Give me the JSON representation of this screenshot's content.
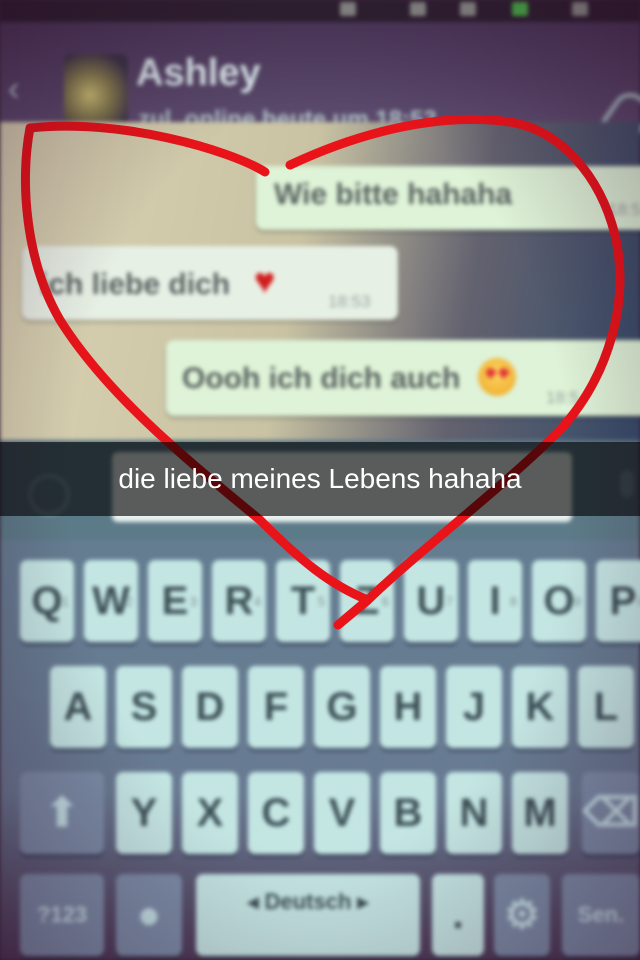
{
  "chat_header": {
    "contact_name": "Ashley",
    "last_seen": "zul. online heute um 18:53"
  },
  "messages": [
    {
      "direction": "outgoing",
      "text": "Wie bitte hahaha",
      "time": "18:5"
    },
    {
      "direction": "incoming",
      "text": "ich liebe dich",
      "emoji": "red-heart",
      "time": "18:53"
    },
    {
      "direction": "outgoing",
      "text": "Oooh ich dich auch",
      "emoji": "heart-eyes-smiley",
      "time": "18:5"
    }
  ],
  "caption": "die liebe meines Lebens hahaha",
  "keyboard": {
    "row1": [
      {
        "label": "Q",
        "num": "1"
      },
      {
        "label": "W",
        "num": "2"
      },
      {
        "label": "E",
        "num": "3"
      },
      {
        "label": "R",
        "num": "4"
      },
      {
        "label": "T",
        "num": "5"
      },
      {
        "label": "Z",
        "num": "6"
      },
      {
        "label": "U",
        "num": "7"
      },
      {
        "label": "I",
        "num": "8"
      },
      {
        "label": "O",
        "num": "9"
      },
      {
        "label": "P",
        "num": "0"
      }
    ],
    "row2": [
      "A",
      "S",
      "D",
      "F",
      "G",
      "H",
      "J",
      "K",
      "L"
    ],
    "row3": [
      "Y",
      "X",
      "C",
      "V",
      "B",
      "N",
      "M"
    ],
    "symbols_key": "?123",
    "space_label": "Deutsch",
    "period": ".",
    "send_key": "Sen."
  },
  "drawing": {
    "shape": "heart",
    "color": "#e8141a"
  }
}
